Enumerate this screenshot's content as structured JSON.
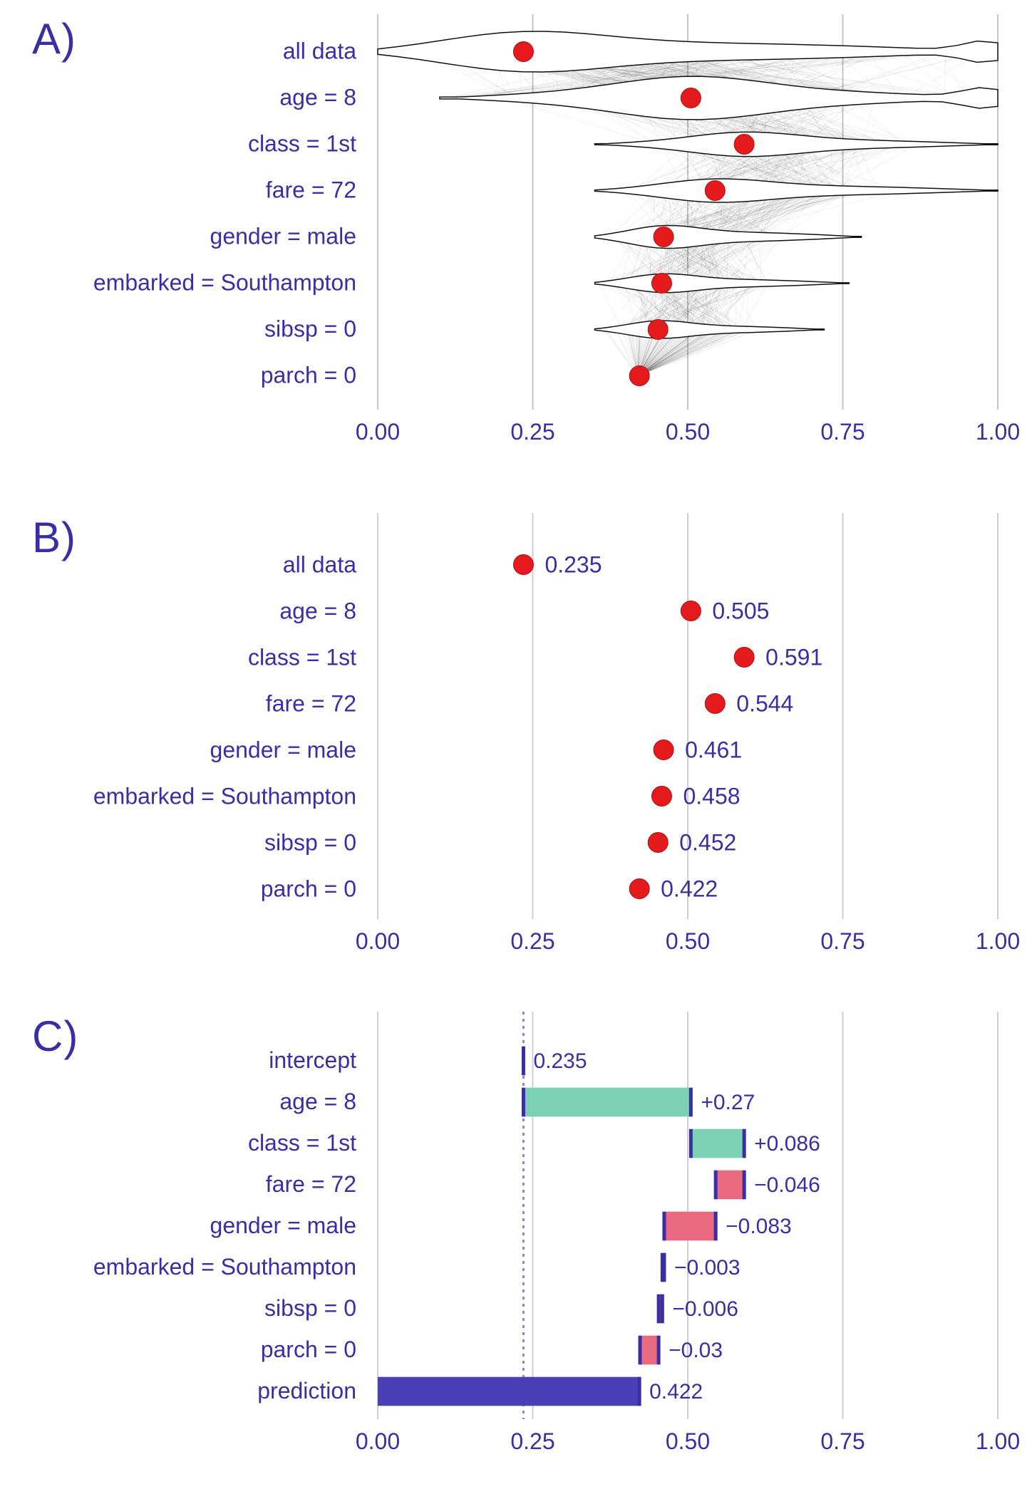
{
  "panels": [
    "A)",
    "B)",
    "C)"
  ],
  "common": {
    "xmin": 0.0,
    "xmax": 1.0,
    "xticks": [
      0.0,
      0.25,
      0.5,
      0.75,
      1.0
    ],
    "xticklabels": [
      "0.00",
      "0.25",
      "0.50",
      "0.75",
      "1.00"
    ]
  },
  "chart_data": [
    {
      "id": "A",
      "type": "violin",
      "title": "",
      "xlabel": "",
      "ylabel": "",
      "xlim": [
        0.0,
        1.0
      ],
      "categories": [
        "all data",
        "age = 8",
        "class = 1st",
        "fare = 72",
        "gender = male",
        "embarked = Southampton",
        "sibsp = 0",
        "parch = 0"
      ],
      "point_values": [
        0.235,
        0.505,
        0.591,
        0.544,
        0.461,
        0.458,
        0.452,
        0.422
      ],
      "violin_extents": [
        [
          0.0,
          1.0
        ],
        [
          0.1,
          1.0
        ],
        [
          0.35,
          1.0
        ],
        [
          0.35,
          1.0
        ],
        [
          0.35,
          0.78
        ],
        [
          0.35,
          0.76
        ],
        [
          0.35,
          0.72
        ],
        [
          0.42,
          0.42
        ]
      ],
      "violin_max_halfwidth": [
        1.0,
        0.95,
        0.55,
        0.55,
        0.55,
        0.45,
        0.42,
        0.05
      ]
    },
    {
      "id": "B",
      "type": "dot",
      "title": "",
      "xlabel": "",
      "ylabel": "",
      "xlim": [
        0.0,
        1.0
      ],
      "categories": [
        "all data",
        "age = 8",
        "class = 1st",
        "fare = 72",
        "gender = male",
        "embarked = Southampton",
        "sibsp = 0",
        "parch = 0"
      ],
      "values": [
        0.235,
        0.505,
        0.591,
        0.544,
        0.461,
        0.458,
        0.452,
        0.422
      ],
      "value_labels": [
        "0.235",
        "0.505",
        "0.591",
        "0.544",
        "0.461",
        "0.458",
        "0.452",
        "0.422"
      ]
    },
    {
      "id": "C",
      "type": "waterfall",
      "title": "",
      "xlabel": "",
      "ylabel": "",
      "xlim": [
        0.0,
        1.0
      ],
      "intercept": 0.235,
      "prediction": 0.422,
      "categories": [
        "intercept",
        "age = 8",
        "class = 1st",
        "fare = 72",
        "gender = male",
        "embarked = Southampton",
        "sibsp = 0",
        "parch = 0",
        "prediction"
      ],
      "bar_labels": [
        "0.235",
        "+0.27",
        "+0.086",
        "−0.046",
        "−0.083",
        "−0.003",
        "−0.006",
        "−0.03",
        "0.422"
      ],
      "contributions": [
        0.235,
        0.27,
        0.086,
        -0.046,
        -0.083,
        -0.003,
        -0.006,
        -0.03,
        0.422
      ]
    }
  ]
}
